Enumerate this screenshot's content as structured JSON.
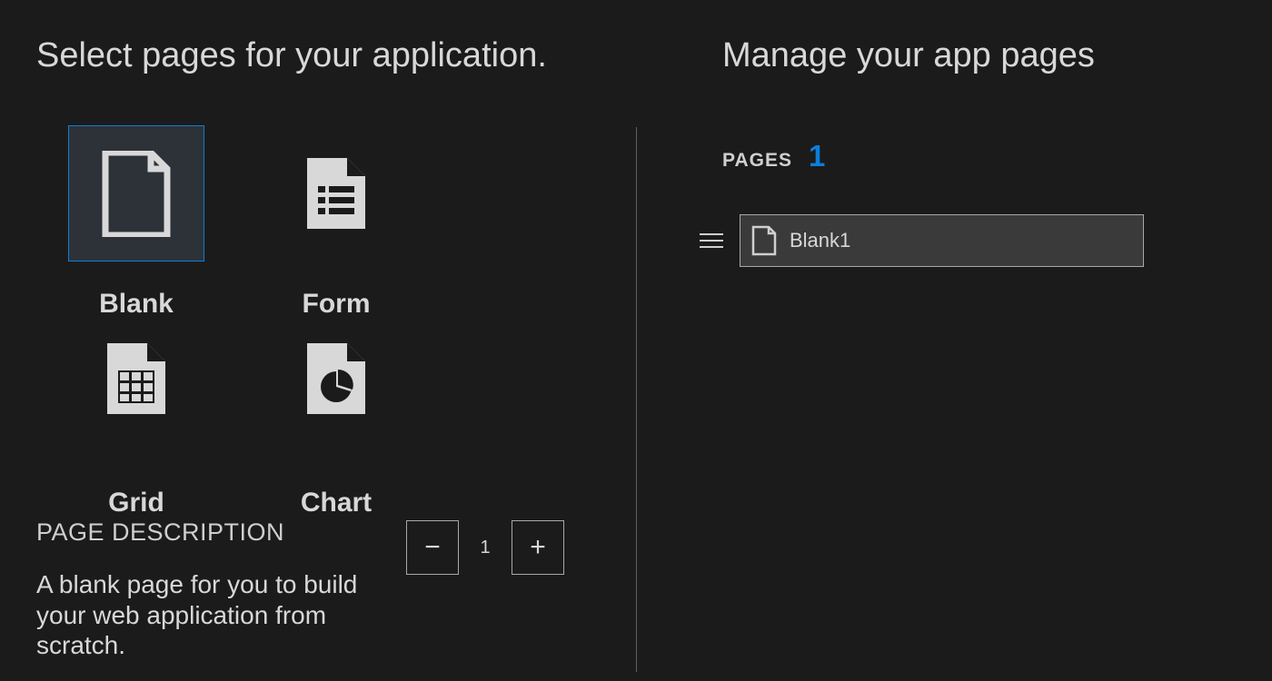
{
  "left": {
    "heading": "Select pages for your application.",
    "templates": [
      {
        "key": "blank",
        "label": "Blank",
        "selected": true
      },
      {
        "key": "form",
        "label": "Form",
        "selected": false
      },
      {
        "key": "grid",
        "label": "Grid",
        "selected": false
      },
      {
        "key": "chart",
        "label": "Chart",
        "selected": false
      }
    ],
    "description_label": "PAGE DESCRIPTION",
    "description_text": "A blank page for you to build your web application from scratch.",
    "stepper": {
      "minus": "−",
      "value": "1",
      "plus": "+"
    }
  },
  "right": {
    "heading": "Manage your app pages",
    "pages_label": "PAGES",
    "pages_count": "1",
    "items": [
      {
        "label": "Blank1"
      }
    ]
  }
}
